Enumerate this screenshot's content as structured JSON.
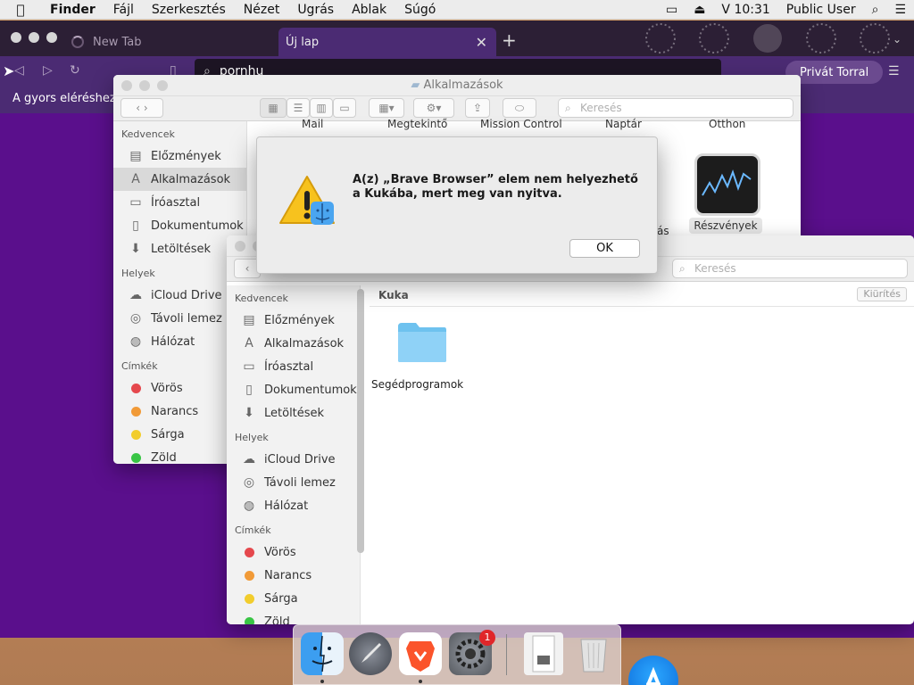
{
  "menubar": {
    "app_name": "Finder",
    "items": [
      "Fájl",
      "Szerkesztés",
      "Nézet",
      "Ugrás",
      "Ablak",
      "Súgó"
    ],
    "clock": "V 10:31",
    "user": "Public User"
  },
  "browser": {
    "tabs": [
      {
        "label": "New Tab"
      },
      {
        "label": "Új lap",
        "close": "✕"
      }
    ],
    "new_tab_symbol": "+",
    "address_value": "pornhu",
    "private_button": "Privát Torral",
    "quickbar_text": "A gyors eléréshez, t"
  },
  "finder_back": {
    "title": "Alkalmazások",
    "search_placeholder": "Keresés",
    "sections": {
      "favorites": "Kedvencek",
      "places": "Helyek",
      "tags": "Címkék"
    },
    "favorites": [
      "Előzmények",
      "Alkalmazások",
      "Íróasztal",
      "Dokumentumok",
      "Letöltések"
    ],
    "places": [
      "iCloud Drive",
      "Távoli lemez",
      "Hálózat"
    ],
    "tags": [
      {
        "label": "Vörös",
        "color": "#e5484d"
      },
      {
        "label": "Narancs",
        "color": "#f19a37"
      },
      {
        "label": "Sárga",
        "color": "#f2cd2d"
      },
      {
        "label": "Zöld",
        "color": "#39c545"
      }
    ],
    "top_apps": [
      "Mail",
      "Megtekintő",
      "Mission Control",
      "Naptár",
      "Otthon"
    ],
    "partial_label": "ás",
    "stocks_label": "Részvények"
  },
  "finder_front": {
    "search_placeholder": "Keresés",
    "sections": {
      "favorites": "Kedvencek",
      "places": "Helyek",
      "tags": "Címkék"
    },
    "favorites": [
      "Előzmények",
      "Alkalmazások",
      "Íróasztal",
      "Dokumentumok",
      "Letöltések"
    ],
    "places": [
      "iCloud Drive",
      "Távoli lemez",
      "Hálózat"
    ],
    "tags": [
      {
        "label": "Vörös",
        "color": "#e5484d"
      },
      {
        "label": "Narancs",
        "color": "#f19a37"
      },
      {
        "label": "Sárga",
        "color": "#f2cd2d"
      },
      {
        "label": "Zöld",
        "color": "#39c545"
      }
    ],
    "path": "Kuka",
    "empty_button": "Kiürítés",
    "item_label": "Segédprogramok"
  },
  "alert": {
    "message": "A(z) „Brave Browser” elem nem helyezhető a Kukába, mert meg van nyitva.",
    "ok_label": "OK"
  },
  "dock": {
    "badge_count": "1"
  }
}
